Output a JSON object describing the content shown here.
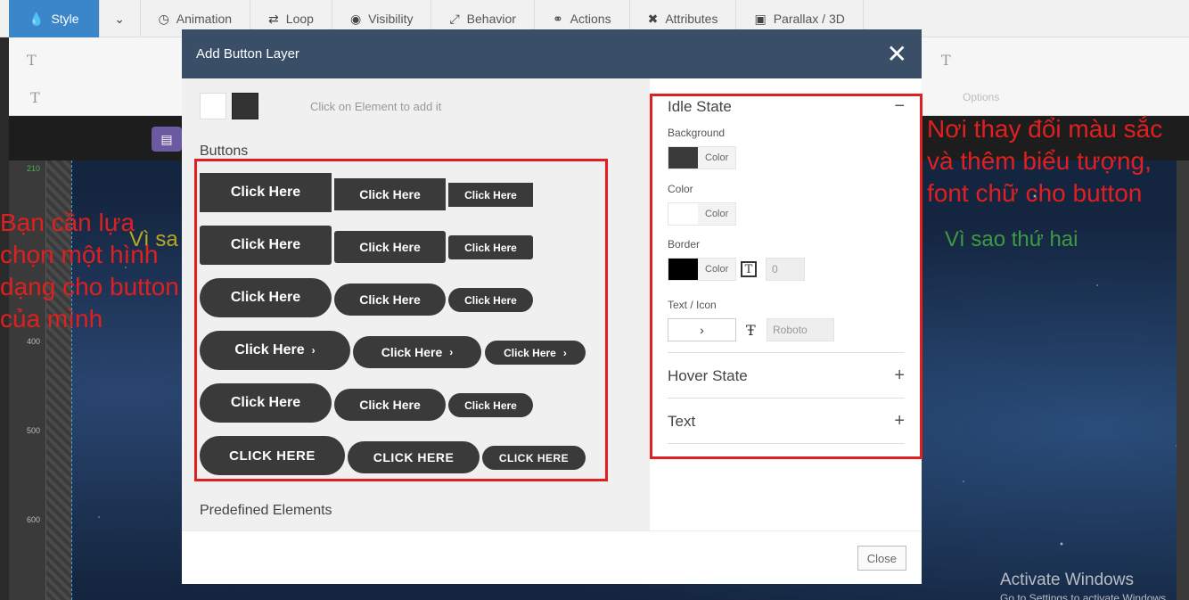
{
  "toolbar": {
    "items": [
      {
        "label": "Style",
        "icon": "drop-icon"
      },
      {
        "label": "Animation",
        "icon": "clock-icon"
      },
      {
        "label": "Loop",
        "icon": "loop-icon"
      },
      {
        "label": "Visibility",
        "icon": "eye-icon"
      },
      {
        "label": "Behavior",
        "icon": "expand-icon"
      },
      {
        "label": "Actions",
        "icon": "link-icon"
      },
      {
        "label": "Attributes",
        "icon": "tools-icon"
      },
      {
        "label": "Parallax / 3D",
        "icon": "image-icon"
      }
    ],
    "accent": "#3a86c8"
  },
  "settings_bar": {
    "glyph": "T",
    "extra_label": "Options"
  },
  "stage": {
    "ruler_ticks": [
      "210",
      "400",
      "500",
      "600"
    ],
    "text_left": "Vì sa",
    "text_right": "Vì sao thứ hai"
  },
  "modal": {
    "title": "Add Button Layer",
    "close_symbol": "✕",
    "hint": "Click on Element to add it",
    "buttons_heading": "Buttons",
    "predefined_heading": "Predefined Elements",
    "button_label": "Click Here",
    "button_label_caps": "CLICK HERE",
    "chevron": "›",
    "footer_close": "Close"
  },
  "panel": {
    "idle_state": "Idle State",
    "collapse_symbol": "−",
    "expand_symbol": "+",
    "background_label": "Background",
    "color_label": "Color",
    "border_label": "Border",
    "text_icon_label": "Text / Icon",
    "color_button": "Color",
    "border_width": "0",
    "font": "Roboto",
    "hover_state": "Hover State",
    "text_section": "Text",
    "colors": {
      "background": "#3a3a3a",
      "color": "#ffffff",
      "border": "#000000"
    }
  },
  "annotations": {
    "left": "Bạn cần lựa chọn một hình dạng cho button của mình",
    "right": "Nơi thay đổi màu sắc và thêm biểu tượng, font chữ cho button",
    "color": "#e02020"
  },
  "watermark": {
    "title": "Activate Windows",
    "subtitle": "Go to Settings to activate Windows."
  }
}
